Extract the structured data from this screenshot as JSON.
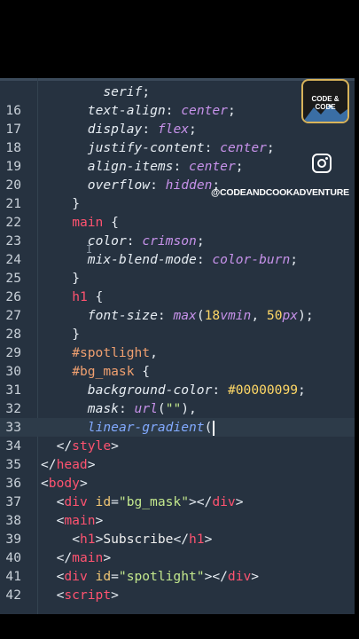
{
  "editor": {
    "lines": [
      {
        "n": "",
        "indent": 4,
        "tokens": [
          [
            "prop",
            "serif"
          ],
          [
            "punc",
            ";"
          ]
        ]
      },
      {
        "n": "16",
        "indent": 3,
        "tokens": [
          [
            "prop",
            "text-align"
          ],
          [
            "punc",
            ": "
          ],
          [
            "val",
            "center"
          ],
          [
            "punc",
            ";"
          ]
        ]
      },
      {
        "n": "17",
        "indent": 3,
        "tokens": [
          [
            "prop",
            "display"
          ],
          [
            "punc",
            ": "
          ],
          [
            "val",
            "flex"
          ],
          [
            "punc",
            ";"
          ]
        ]
      },
      {
        "n": "18",
        "indent": 3,
        "tokens": [
          [
            "prop",
            "justify-content"
          ],
          [
            "punc",
            ": "
          ],
          [
            "val",
            "center"
          ],
          [
            "punc",
            ";"
          ]
        ]
      },
      {
        "n": "19",
        "indent": 3,
        "tokens": [
          [
            "prop",
            "align-items"
          ],
          [
            "punc",
            ": "
          ],
          [
            "val",
            "center"
          ],
          [
            "punc",
            ";"
          ]
        ]
      },
      {
        "n": "20",
        "indent": 3,
        "tokens": [
          [
            "prop",
            "overflow"
          ],
          [
            "punc",
            ": "
          ],
          [
            "val",
            "hidden"
          ],
          [
            "punc",
            ";"
          ]
        ]
      },
      {
        "n": "21",
        "indent": 2,
        "tokens": [
          [
            "punc",
            "}"
          ]
        ]
      },
      {
        "n": "22",
        "indent": 2,
        "tokens": [
          [
            "sel",
            "main"
          ],
          [
            "punc",
            " {"
          ]
        ]
      },
      {
        "n": "23",
        "indent": 3,
        "tokens": [
          [
            "prop",
            "color"
          ],
          [
            "punc",
            ": "
          ],
          [
            "val",
            "crimson"
          ],
          [
            "punc",
            ";"
          ]
        ]
      },
      {
        "n": "24",
        "indent": 3,
        "tokens": [
          [
            "prop",
            "mix-blend-mode"
          ],
          [
            "punc",
            ": "
          ],
          [
            "val",
            "color-burn"
          ],
          [
            "punc",
            ";"
          ]
        ]
      },
      {
        "n": "25",
        "indent": 2,
        "tokens": [
          [
            "punc",
            "}"
          ]
        ]
      },
      {
        "n": "26",
        "indent": 2,
        "tokens": [
          [
            "sel",
            "h1"
          ],
          [
            "punc",
            " {"
          ]
        ]
      },
      {
        "n": "27",
        "indent": 3,
        "tokens": [
          [
            "prop",
            "font-size"
          ],
          [
            "punc",
            ": "
          ],
          [
            "val",
            "max"
          ],
          [
            "punc",
            "("
          ],
          [
            "num",
            "18"
          ],
          [
            "unit",
            "vmin"
          ],
          [
            "punc",
            ", "
          ],
          [
            "num",
            "50"
          ],
          [
            "unit",
            "px"
          ],
          [
            "punc",
            ");"
          ]
        ]
      },
      {
        "n": "28",
        "indent": 2,
        "tokens": [
          [
            "punc",
            "}"
          ]
        ]
      },
      {
        "n": "29",
        "indent": 2,
        "tokens": [
          [
            "selb",
            "#spotlight"
          ],
          [
            "punc",
            ","
          ]
        ]
      },
      {
        "n": "30",
        "indent": 2,
        "tokens": [
          [
            "selb",
            "#bg_mask"
          ],
          [
            "punc",
            " {"
          ]
        ]
      },
      {
        "n": "31",
        "indent": 3,
        "tokens": [
          [
            "prop",
            "background-color"
          ],
          [
            "punc",
            ": "
          ],
          [
            "num",
            "#00000099"
          ],
          [
            "punc",
            ";"
          ]
        ]
      },
      {
        "n": "32",
        "indent": 3,
        "tokens": [
          [
            "prop",
            "mask"
          ],
          [
            "punc",
            ": "
          ],
          [
            "val",
            "url"
          ],
          [
            "punc",
            "("
          ],
          [
            "str",
            "\"\""
          ],
          [
            "punc",
            "),"
          ]
        ]
      },
      {
        "n": "33",
        "indent": 3,
        "current": true,
        "tokens": [
          [
            "fn",
            "linear-gradient"
          ],
          [
            "punc",
            "("
          ]
        ]
      },
      {
        "n": "34",
        "indent": 1,
        "tokens": [
          [
            "punc",
            "</"
          ],
          [
            "tag",
            "style"
          ],
          [
            "punc",
            ">"
          ]
        ]
      },
      {
        "n": "35",
        "indent": 0,
        "tokens": [
          [
            "punc",
            "</"
          ],
          [
            "tag",
            "head"
          ],
          [
            "punc",
            ">"
          ]
        ]
      },
      {
        "n": "36",
        "indent": 0,
        "tokens": [
          [
            "punc",
            "<"
          ],
          [
            "tag",
            "body"
          ],
          [
            "punc",
            ">"
          ]
        ]
      },
      {
        "n": "37",
        "indent": 1,
        "tokens": [
          [
            "punc",
            "<"
          ],
          [
            "tag",
            "div"
          ],
          [
            "attr",
            " id"
          ],
          [
            "punc",
            "="
          ],
          [
            "str",
            "\"bg_mask\""
          ],
          [
            "punc",
            "></"
          ],
          [
            "tag",
            "div"
          ],
          [
            "punc",
            ">"
          ]
        ]
      },
      {
        "n": "38",
        "indent": 1,
        "tokens": [
          [
            "punc",
            "<"
          ],
          [
            "tag",
            "main"
          ],
          [
            "punc",
            ">"
          ]
        ]
      },
      {
        "n": "39",
        "indent": 2,
        "tokens": [
          [
            "punc",
            "<"
          ],
          [
            "tag",
            "h1"
          ],
          [
            "punc",
            ">"
          ],
          [
            "txt",
            "Subscribe"
          ],
          [
            "punc",
            "</"
          ],
          [
            "tag",
            "h1"
          ],
          [
            "punc",
            ">"
          ]
        ]
      },
      {
        "n": "40",
        "indent": 1,
        "tokens": [
          [
            "punc",
            "</"
          ],
          [
            "tag",
            "main"
          ],
          [
            "punc",
            ">"
          ]
        ]
      },
      {
        "n": "41",
        "indent": 1,
        "tokens": [
          [
            "punc",
            "<"
          ],
          [
            "tag",
            "div"
          ],
          [
            "attr",
            " id"
          ],
          [
            "punc",
            "="
          ],
          [
            "str",
            "\"spotlight\""
          ],
          [
            "punc",
            "></"
          ],
          [
            "tag",
            "div"
          ],
          [
            "punc",
            ">"
          ]
        ]
      },
      {
        "n": "42",
        "indent": 1,
        "tokens": [
          [
            "punc",
            "<"
          ],
          [
            "tag",
            "script"
          ],
          [
            "punc",
            ">"
          ]
        ]
      }
    ]
  },
  "overlay": {
    "logo_text": "CODE & CODE",
    "logo_icon": "mountain-logo-icon",
    "instagram_icon": "instagram-icon",
    "handle": "@CODEANDCOOKADVENTURE"
  }
}
